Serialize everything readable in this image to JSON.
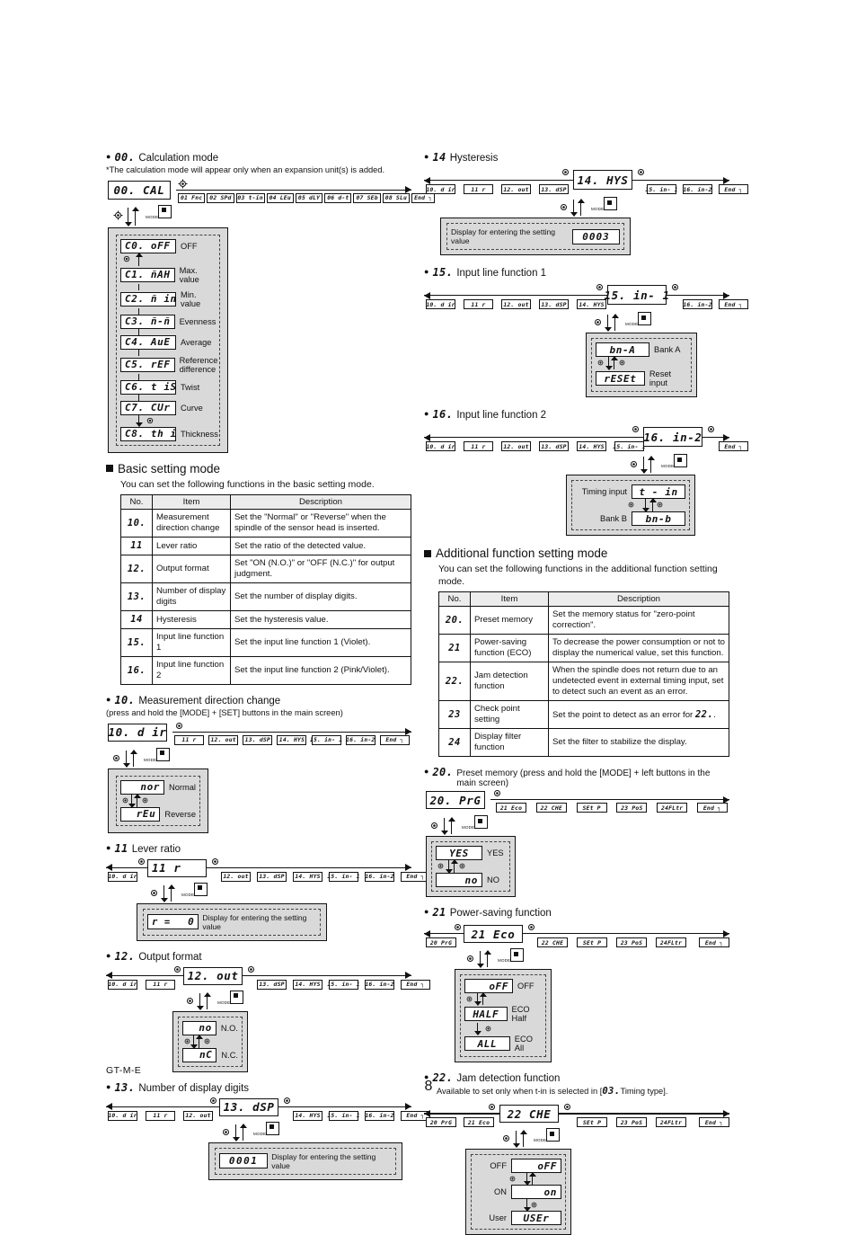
{
  "footer": {
    "doc_code": "GT-M-E",
    "page_number": "8"
  },
  "left": {
    "calc_mode": {
      "bullet": "●",
      "code": "00.",
      "title": "Calculation mode",
      "note": "*The calculation mode will appear only when an expansion unit(s) is added.",
      "head_lcd": "00. CAL",
      "chain": [
        "01 Fnc",
        "02 SPd",
        "03 t-in",
        "04 LEu",
        "05 dLY",
        "06 d-t",
        "07 SEb",
        "08 SLu",
        "End ┐"
      ],
      "options": [
        {
          "lcd": "C0. oFF",
          "label": "OFF"
        },
        {
          "lcd": "C1. ñAH",
          "label": "Max. value"
        },
        {
          "lcd": "C2. ñ in",
          "label": "Min. value"
        },
        {
          "lcd": "C3. ñ-ñ",
          "label": "Evenness"
        },
        {
          "lcd": "C4. AuE",
          "label": "Average"
        },
        {
          "lcd": "C5. rEF",
          "label": "Reference difference"
        },
        {
          "lcd": "C6. t iS",
          "label": "Twist"
        },
        {
          "lcd": "C7. CUr",
          "label": "Curve"
        },
        {
          "lcd": "C8. th i",
          "label": "Thickness"
        }
      ]
    },
    "basic_mode": {
      "heading": "Basic setting mode",
      "subtitle": "You can set the following functions in the basic setting mode.",
      "columns": [
        "No.",
        "Item",
        "Description"
      ],
      "rows": [
        {
          "no": "10.",
          "item": "Measurement direction change",
          "desc": "Set the \"Normal\" or \"Reverse\" when the spindle of the sensor head is inserted."
        },
        {
          "no": "11",
          "item": "Lever ratio",
          "desc": "Set the ratio of the detected value."
        },
        {
          "no": "12.",
          "item": "Output format",
          "desc": "Set \"ON (N.O.)\" or \"OFF (N.C.)\" for output judgment."
        },
        {
          "no": "13.",
          "item": "Number of display digits",
          "desc": "Set the number of display digits."
        },
        {
          "no": "14",
          "item": "Hysteresis",
          "desc": "Set the hysteresis value."
        },
        {
          "no": "15.",
          "item": "Input line function 1",
          "desc": "Set the input line function 1 (Violet)."
        },
        {
          "no": "16.",
          "item": "Input line function 2",
          "desc": "Set the input line function 2 (Pink/Violet)."
        }
      ]
    },
    "dir_change": {
      "code": "10.",
      "title": "Measurement direction change",
      "note": "(press and hold the [MODE] + [SET] buttons in the main screen)",
      "head_lcd": "10. d ir",
      "chain": [
        "11   r",
        "12. out",
        "13. dSP",
        "14. HYS",
        "15. in- 1",
        "16. in-2",
        "End ┐"
      ],
      "options": [
        {
          "lcd": "nor",
          "label": "Normal"
        },
        {
          "lcd": "rEu",
          "label": "Reverse"
        }
      ]
    },
    "lever_ratio": {
      "code": "11",
      "title": "Lever ratio",
      "head_lcd": "11       r",
      "chain": [
        "10. d ir",
        "",
        "12. out",
        "13. dSP",
        "14. HYS",
        "15. in- 1",
        "16. in-2",
        "End ┐"
      ],
      "value_lcd_left": "r =",
      "value_lcd_right": "0",
      "value_label": "Display for entering the setting value"
    },
    "output_format": {
      "code": "12.",
      "title": "Output format",
      "head_lcd": "12. out",
      "chain": [
        "10. d ir",
        "11   r",
        "",
        "13. dSP",
        "14. HYS",
        "15. in- 1",
        "16. in-2",
        "End ┐"
      ],
      "options": [
        {
          "lcd": "no",
          "label": "N.O."
        },
        {
          "lcd": "nC",
          "label": "N.C."
        }
      ]
    },
    "display_digits": {
      "code": "13.",
      "title": "Number of display digits",
      "head_lcd": "13. dSP",
      "chain": [
        "10. d ir",
        "11   r",
        "12. out",
        "",
        "14. HYS",
        "15. in- 1",
        "16. in-2",
        "End ┐"
      ],
      "value_lcd": "0001",
      "value_label": "Display for entering the setting value"
    }
  },
  "right": {
    "hysteresis": {
      "code": "14",
      "title": "Hysteresis",
      "head_lcd": "14. HYS",
      "chain": [
        "10. d ir",
        "11   r",
        "12. out",
        "13. dSP",
        "",
        "15. in- 1",
        "16. in-2",
        "End ┐"
      ],
      "value_label": "Display for entering the setting value",
      "value_lcd": "0003"
    },
    "input_line_1": {
      "code": "15.",
      "title": "Input line function 1",
      "head_lcd": "15. in- 1",
      "chain": [
        "10. d ir",
        "11   r",
        "12. out",
        "13. dSP",
        "14. HYS",
        "",
        "16. in-2",
        "End ┐"
      ],
      "options": [
        {
          "lcd": "bn-A",
          "label": "Bank A"
        },
        {
          "lcd": "rESEt",
          "label": "Reset input"
        }
      ]
    },
    "input_line_2": {
      "code": "16.",
      "title": "Input line function 2",
      "head_lcd": "16. in-2",
      "chain": [
        "10. d ir",
        "11   r",
        "12. out",
        "13. dSP",
        "14. HYS",
        "15. in- 1",
        "",
        "End ┐"
      ],
      "options": [
        {
          "label": "Timing input",
          "lcd": "t - in"
        },
        {
          "label": "Bank B",
          "lcd": "bn-b"
        }
      ]
    },
    "additional_mode": {
      "heading": "Additional function setting mode",
      "subtitle": "You can set the following functions in the additional function setting mode.",
      "columns": [
        "No.",
        "Item",
        "Description"
      ],
      "rows": [
        {
          "no": "20.",
          "item": "Preset memory",
          "desc": "Set the memory status for \"zero-point correction\"."
        },
        {
          "no": "21",
          "item": "Power-saving function (ECO)",
          "desc": "To decrease the power consumption or not to display the numerical value, set this function."
        },
        {
          "no": "22.",
          "item": "Jam detection function",
          "desc": "When the spindle does not return due to an undetected event in external timing input, set to detect such an event as an error."
        },
        {
          "no": "23",
          "item": "Check point setting",
          "desc": "Set the point to detect as an error for",
          "desc_code": "22.",
          "desc_tail": "."
        },
        {
          "no": "24",
          "item": "Display filter function",
          "desc": "Set the filter to stabilize the display."
        }
      ]
    },
    "preset_memory": {
      "code": "20.",
      "title": "Preset memory (press and hold the [MODE] + left buttons in the main screen)",
      "head_lcd": "20. PrG",
      "chain": [
        "21 Eco",
        "22 CHE",
        "SEt  P",
        "23 PoS",
        "24FLtr",
        "End ┐"
      ],
      "options": [
        {
          "lcd": "YES",
          "label": "YES"
        },
        {
          "lcd": "no",
          "label": "NO"
        }
      ]
    },
    "power_saving": {
      "code": "21",
      "title": "Power-saving function",
      "head_lcd": "21 Eco",
      "chain_left": [
        "20 PrG"
      ],
      "chain": [
        "22 CHE",
        "SEt  P",
        "23 PoS",
        "24FLtr",
        "End ┐"
      ],
      "options": [
        {
          "lcd": "oFF",
          "label": "OFF"
        },
        {
          "lcd": "HALF",
          "label": "ECO Half"
        },
        {
          "lcd": "ALL",
          "label": "ECO All"
        }
      ]
    },
    "jam_detection": {
      "code": "22.",
      "title": "Jam detection function",
      "note_pre": "Available to set only when t-in is selected in [",
      "note_code": "03.",
      "note_post": "Timing type].",
      "head_lcd": "22 CHE",
      "chain_left": [
        "20 PrG",
        "21 Eco"
      ],
      "chain": [
        "SEt  P",
        "23 PoS",
        "24FLtr",
        "End ┐"
      ],
      "options": [
        {
          "label": "OFF",
          "lcd": "oFF"
        },
        {
          "label": "ON",
          "lcd": "on"
        },
        {
          "label": "User",
          "lcd": "USEr"
        }
      ]
    }
  }
}
